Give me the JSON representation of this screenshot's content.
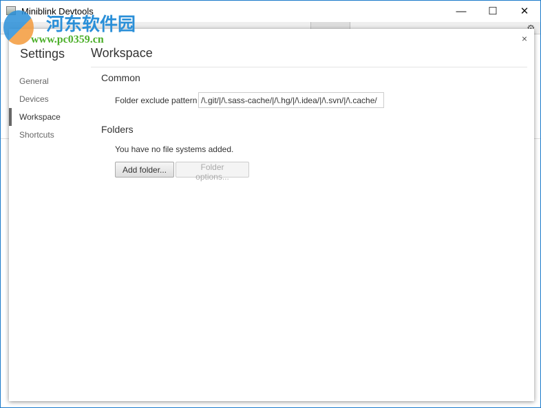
{
  "window": {
    "title": "Miniblink Devtools",
    "minimize": "—",
    "maximize": "☐",
    "close": "✕"
  },
  "watermark": {
    "cn": "河东软件园",
    "url": "www.pc0359.cn"
  },
  "dialog": {
    "close": "×",
    "settings_title": "Settings",
    "nav": [
      {
        "label": "General"
      },
      {
        "label": "Devices"
      },
      {
        "label": "Workspace",
        "selected": true
      },
      {
        "label": "Shortcuts"
      }
    ],
    "page_title": "Workspace",
    "common": {
      "heading": "Common",
      "pattern_label": "Folder exclude pattern",
      "pattern_value": "/\\.git/|/\\.sass-cache/|/\\.hg/|/\\.idea/|/\\.svn/|/\\.cache/"
    },
    "folders": {
      "heading": "Folders",
      "empty_text": "You have no file systems added.",
      "add_button": "Add folder...",
      "options_button": "Folder options..."
    }
  }
}
